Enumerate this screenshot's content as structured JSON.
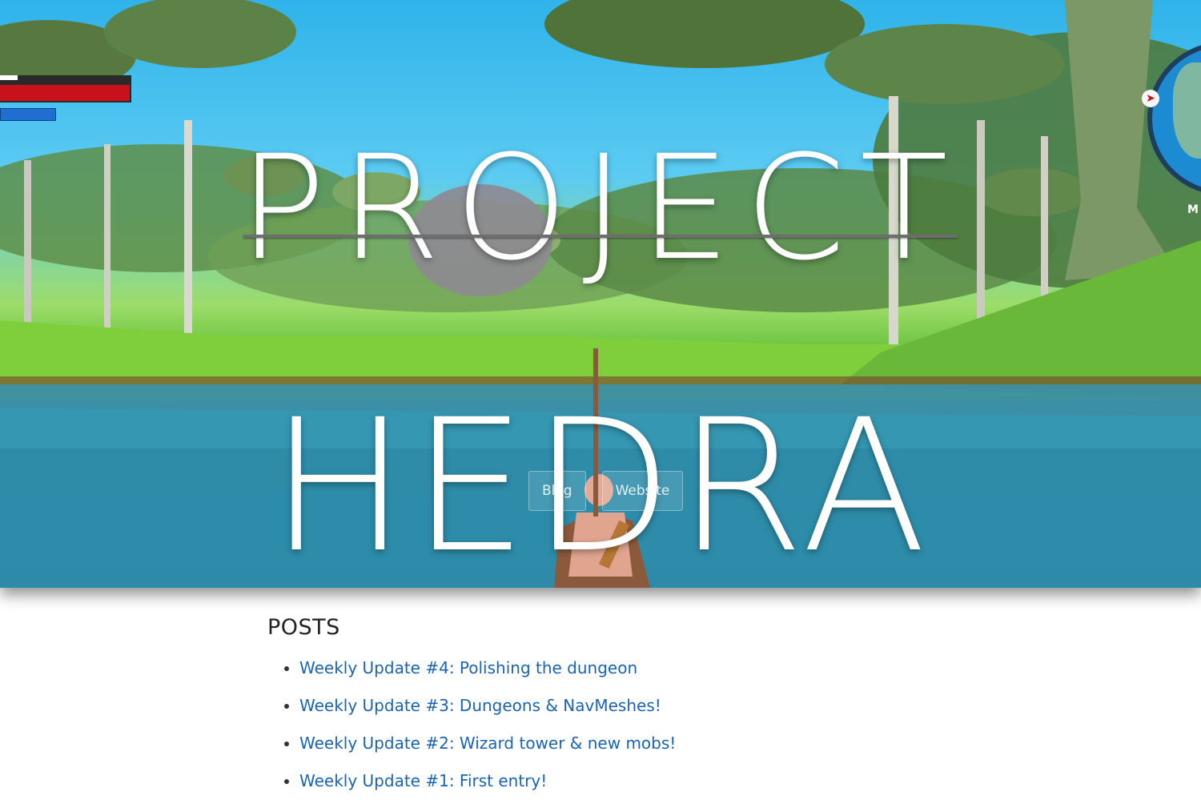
{
  "hero": {
    "title_top": "PROJECT",
    "title_bottom": "HEDRA",
    "hud_map_label": "M",
    "compass_glyph": "➤"
  },
  "nav": {
    "blog_label": "Blog",
    "website_label": "Website"
  },
  "posts": {
    "heading": "POSTS",
    "items": [
      {
        "title": "Weekly Update #4: Polishing the dungeon"
      },
      {
        "title": "Weekly Update #3: Dungeons & NavMeshes!"
      },
      {
        "title": "Weekly Update #2: Wizard tower & new mobs!"
      },
      {
        "title": "Weekly Update #1: First entry!"
      }
    ]
  },
  "colors": {
    "link": "#1a64b6",
    "heading": "#222222",
    "health": "#c8111b",
    "mana": "#1f6ed0"
  }
}
